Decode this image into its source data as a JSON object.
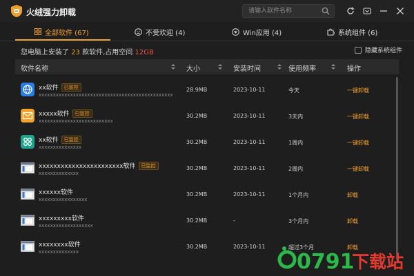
{
  "window": {
    "title": "火绒强力卸载",
    "search_placeholder": "请输入软件名称"
  },
  "tabs": [
    {
      "label": "全部软件 (67)",
      "icon": "grid-icon",
      "active": true
    },
    {
      "label": "不受欢迎 (4)",
      "icon": "frown-icon",
      "active": false
    },
    {
      "label": "Win应用 (4)",
      "icon": "windows-icon",
      "active": false
    },
    {
      "label": "系统组件 (6)",
      "icon": "puzzle-icon",
      "active": false
    }
  ],
  "summary": {
    "prefix": "您电脑上安装了",
    "count": "23",
    "middle": "款软件,占用空间",
    "space": "12GB"
  },
  "hide_system_label": "隐藏系统组件",
  "columns": {
    "name": "软件名称",
    "size": "大小",
    "date": "安装时间",
    "freq": "使用频率",
    "action": "操作"
  },
  "rows": [
    {
      "name": "xx软件",
      "badge": "已监控",
      "sub": "xxxxxxxxxxxxxxxxxxxxxxxxxxxxxxxxxxxxxxxxxxxxxxx",
      "size": "28.9MB",
      "date": "2023-10-11",
      "freq": "今天",
      "action": "一键卸载",
      "icon": "globe-icon"
    },
    {
      "name": "xxxxx软件",
      "badge": "已监控",
      "sub": "xxxxxxxxxxxxxxxxxxxxxxxxxx",
      "size": "30.2MB",
      "date": "2023-10-11",
      "freq": "3天内",
      "action": "一键卸载",
      "icon": "mail-icon"
    },
    {
      "name": "xx软件",
      "badge": "已监控",
      "sub": "xxxxxxxxxxxxxxx",
      "size": "30.2MB",
      "date": "2023-10-11",
      "freq": "1周内",
      "action": "一键卸载",
      "icon": "command-icon"
    },
    {
      "name": "xxxxxxxxxxxxxxxxxxxxxxx软件",
      "badge": "已监控",
      "sub": "xxxxxxxxxxxxxx",
      "size": "30.2MB",
      "date": "2023-10-11",
      "freq": "2周内",
      "action": "一键卸载",
      "icon": "window-app-icon"
    },
    {
      "name": "xxxxxx软件",
      "badge": "",
      "sub": "xxxxxxxxxxxxxxxxx",
      "size": "30.2MB",
      "date": "2023-10-11",
      "freq": "1个月内",
      "action": "卸载",
      "icon": "window-app-icon"
    },
    {
      "name": "xxxxxxxxx软件",
      "badge": "",
      "sub": "xxxxxxxxxxxxxxxxxxx",
      "size": "30.2MB",
      "date": "-",
      "freq": "3个月内",
      "action": "卸载",
      "icon": "window-app-icon"
    },
    {
      "name": "xxxxxxxx软件",
      "badge": "",
      "sub": "xxxxxxxxxxxxxx",
      "size": "30.2MB",
      "date": "2023-10-11",
      "freq": "超过3个月",
      "action": "卸载",
      "icon": "window-app-icon"
    }
  ],
  "watermark": {
    "digits": "0791",
    "text": "下载站"
  },
  "colors": {
    "accent": "#f0a030",
    "space": "#e55a4a",
    "bg": "#1e1e1e"
  }
}
